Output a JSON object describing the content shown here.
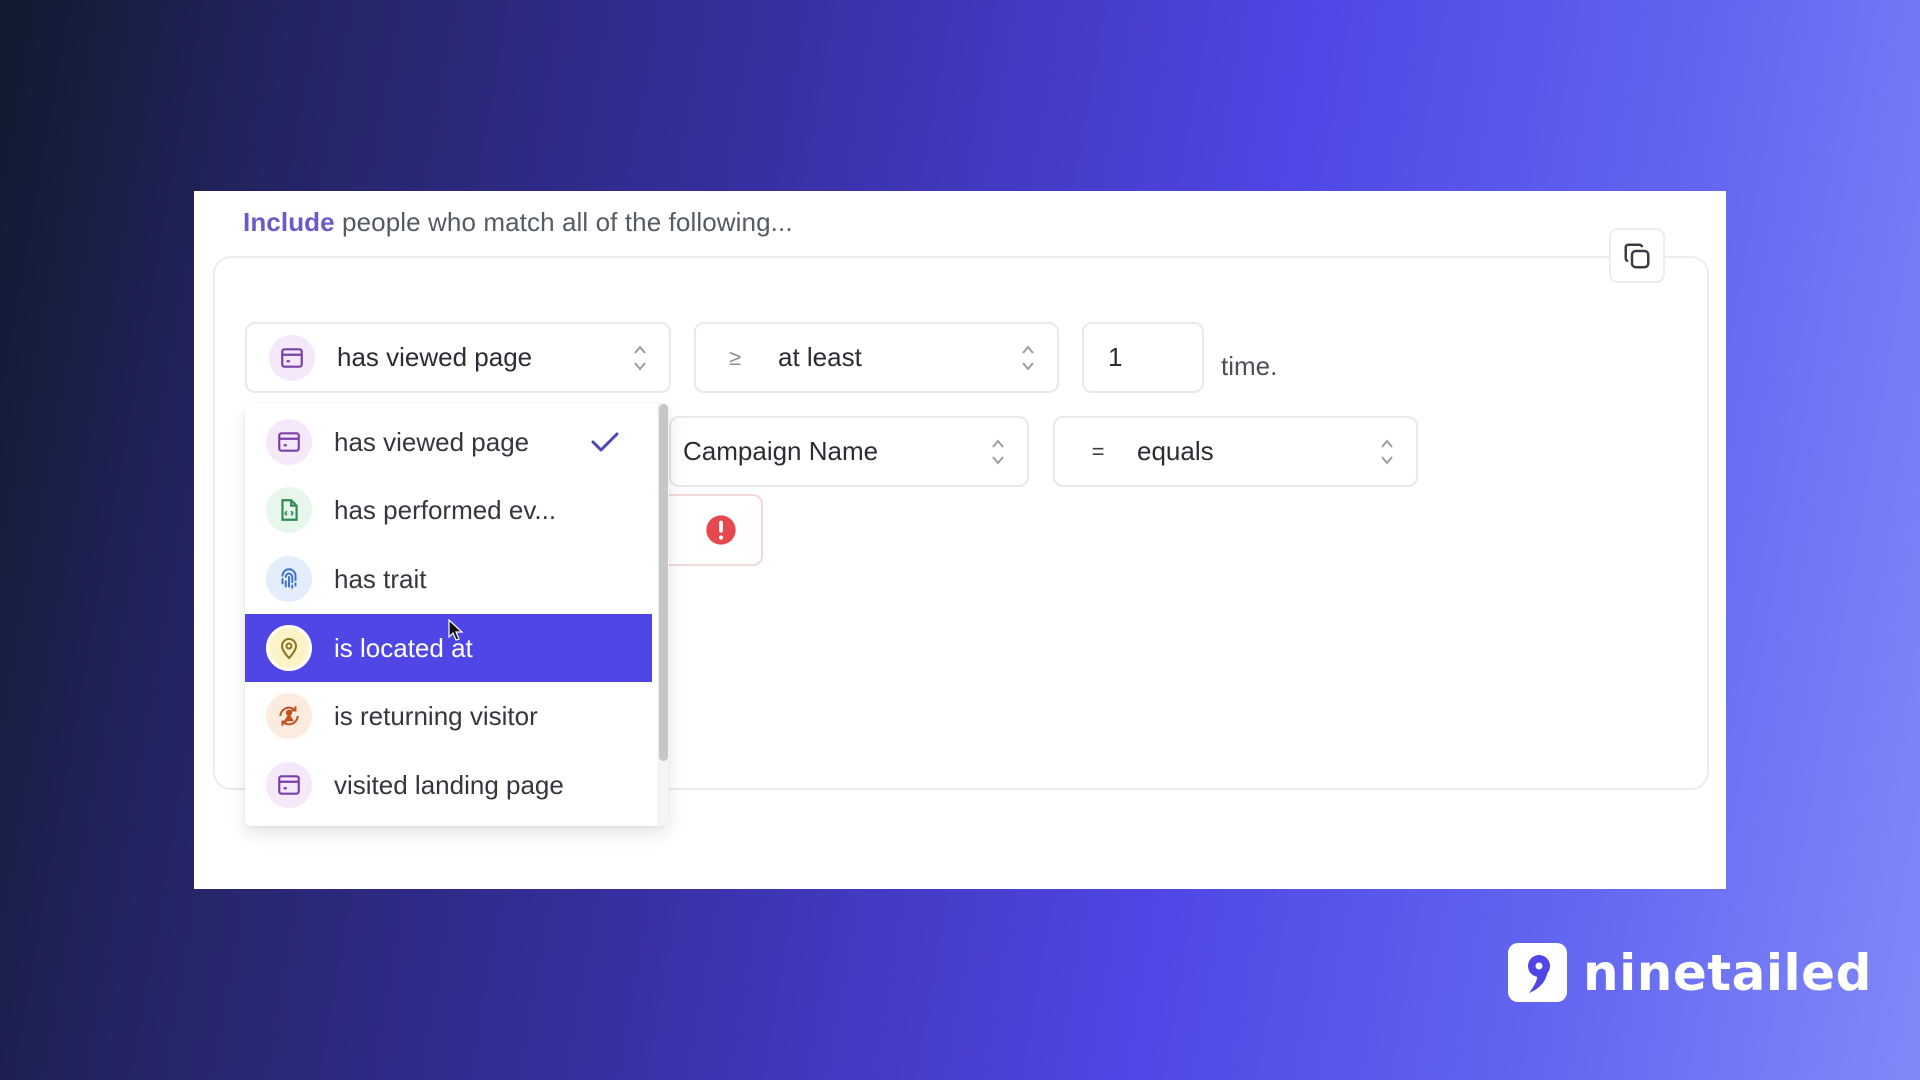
{
  "segment": {
    "heading_keyword": "Include",
    "heading_rest": " people who match all of the following...",
    "copy_button_icon": "copy-icon"
  },
  "row1": {
    "condition_select": {
      "icon": "browser-window-icon",
      "value": "has viewed page"
    },
    "operator_select": {
      "symbol": "≥",
      "value": "at least"
    },
    "count_input": {
      "value": "1"
    },
    "suffix": "time."
  },
  "row2": {
    "property_select": {
      "value": "Campaign Name"
    },
    "comparator_select": {
      "symbol": "=",
      "value": "equals"
    },
    "value_input": {
      "value": "",
      "status": "error",
      "status_icon": "exclamation-circle-icon"
    }
  },
  "dropdown": {
    "items": [
      {
        "label": "has viewed page",
        "icon": "browser-window-icon",
        "selected": true,
        "highlighted": false
      },
      {
        "label": "has performed ev...",
        "icon": "code-file-icon",
        "selected": false,
        "highlighted": false
      },
      {
        "label": "has trait",
        "icon": "fingerprint-icon",
        "selected": false,
        "highlighted": false
      },
      {
        "label": "is located at",
        "icon": "map-pin-icon",
        "selected": false,
        "highlighted": true
      },
      {
        "label": "is returning visitor",
        "icon": "returning-visitor-icon",
        "selected": false,
        "highlighted": false
      },
      {
        "label": "visited landing page",
        "icon": "browser-window-icon",
        "selected": false,
        "highlighted": false
      }
    ]
  },
  "brand": {
    "name": "ninetailed",
    "mark": "9"
  },
  "colors": {
    "accent": "#4f46e5",
    "include_text": "#6a5cc7",
    "error": "#e5484d"
  }
}
